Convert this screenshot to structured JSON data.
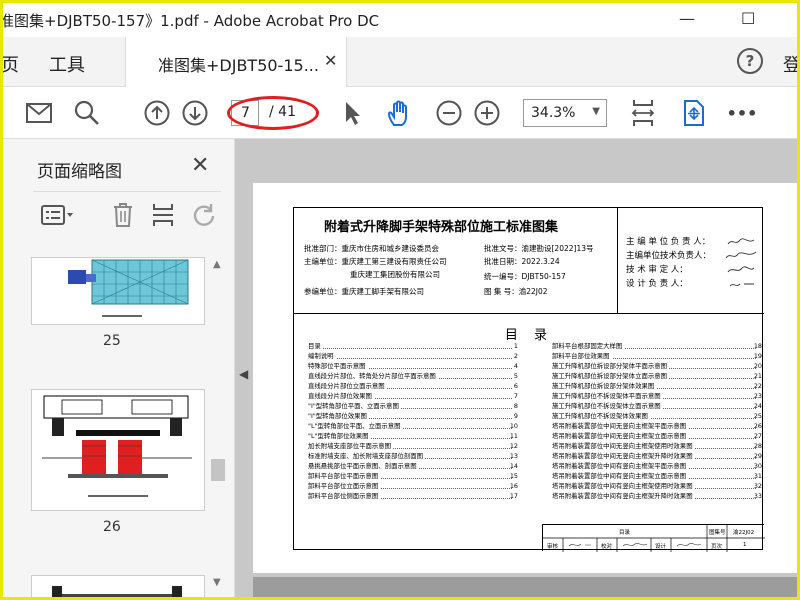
{
  "window": {
    "title": "准图集+DJBT50-157》1.pdf - Adobe Acrobat Pro DC",
    "minimize_label": "—",
    "maximize_label": "☐"
  },
  "tabs": {
    "home_label": "页",
    "tools_label": "工具",
    "doc_tab_label": "准图集+DJBT50-15...",
    "close_label": "✕",
    "help_label": "?",
    "signin_label": "登"
  },
  "toolbar": {
    "page_current": "7",
    "page_total": "/ 41",
    "zoom": "34.3%",
    "more_label": "•••"
  },
  "left_panel": {
    "title": "页面缩略图",
    "close_label": "✕",
    "thumbnails": [
      {
        "page": "25"
      },
      {
        "page": "26"
      }
    ]
  },
  "document": {
    "title": "附着式升降脚手架特殊部位施工标准图集",
    "approval_dept": "批准部门：重庆市住房和城乡建设委员会",
    "editor_unit_1": "主编单位：重庆建工第三建设有限责任公司",
    "editor_unit_2": "重庆建工集团股份有限公司",
    "participant_unit": "参编单位：重庆建工脚手架有限公司",
    "approval_no": "批准文号：渝建勘设[2022]13号",
    "approval_date": "批准日期：2022.3.24",
    "unified_no": "统一编号：DJBT50-157",
    "atlas_no": "图 集 号：渝22J02",
    "resp_1": "主 编 单 位 负 责 人：",
    "resp_2": "主编单位技术负责人：",
    "resp_3": "技  术  审  定  人：",
    "resp_4": "设  计  负  责  人：",
    "toc_title": "目 录",
    "toc_left": [
      {
        "name": "目录",
        "page": "1"
      },
      {
        "name": "编制说明",
        "page": "2"
      },
      {
        "name": "特殊部位平面示意图",
        "page": "4"
      },
      {
        "name": "直线段分片部位、转角处分片部位平面示意图",
        "page": "5"
      },
      {
        "name": "直线段分片部位立面示意图",
        "page": "6"
      },
      {
        "name": "直线段分片部位效果图",
        "page": "7"
      },
      {
        "name": "\"I\"型转角部位平面、立面示意图",
        "page": "8"
      },
      {
        "name": "\"I\"型转角部位效果图",
        "page": "9"
      },
      {
        "name": "\"L\"型转角部位平面、立面示意图",
        "page": "10"
      },
      {
        "name": "\"L\"型转角部位效果图",
        "page": "11"
      },
      {
        "name": "加长附墙支座部位平面示意图",
        "page": "12"
      },
      {
        "name": "标准附墙支座、加长附墙支座部位剖面图",
        "page": "13"
      },
      {
        "name": "悬挑悬挑部位平面示意图、剖面示意图",
        "page": "14"
      },
      {
        "name": "卸料平台部位平面示意图",
        "page": "15"
      },
      {
        "name": "卸料平台部位立面示意图",
        "page": "16"
      },
      {
        "name": "卸料平台部位侧面示意图",
        "page": "17"
      }
    ],
    "toc_right": [
      {
        "name": "卸料平台根部固定大样图",
        "page": "18"
      },
      {
        "name": "卸料平台部位效果图",
        "page": "19"
      },
      {
        "name": "施工升降机部位拆设部分架体平面示意图",
        "page": "20"
      },
      {
        "name": "施工升降机部位拆设部分架体立面示意图",
        "page": "21"
      },
      {
        "name": "施工升降机部位拆设部分架体效果图",
        "page": "22"
      },
      {
        "name": "施工升降机部位不拆设架体平面示意图",
        "page": "23"
      },
      {
        "name": "施工升降机部位不拆设架体立面示意图",
        "page": "24"
      },
      {
        "name": "施工升降机部位不拆设架体效果图",
        "page": "25"
      },
      {
        "name": "塔吊附着装置部位中间无竖向主框架平面示意图",
        "page": "26"
      },
      {
        "name": "塔吊附着装置部位中间无竖向主框架立面示意图",
        "page": "27"
      },
      {
        "name": "塔吊附着装置部位中间无竖向主框架使用时效果图",
        "page": "28"
      },
      {
        "name": "塔吊附着装置部位中间无竖向主框架升降时效果图",
        "page": "29"
      },
      {
        "name": "塔吊附着装置部位中间有竖向主框架平面示意图",
        "page": "30"
      },
      {
        "name": "塔吊附着装置部位中间有竖向主框架立面示意图",
        "page": "31"
      },
      {
        "name": "塔吊附着装置部位中间有竖向主框架使用时效果图",
        "page": "32"
      },
      {
        "name": "塔吊附着装置部位中间有竖向主框架升降时效果图",
        "page": "33"
      }
    ],
    "title_block": {
      "name": "目录",
      "atlas_label": "图集号",
      "atlas_value": "渝22J02",
      "review": "审核",
      "check": "校对",
      "design": "设计",
      "page_label": "页次",
      "page_value": "1"
    }
  }
}
